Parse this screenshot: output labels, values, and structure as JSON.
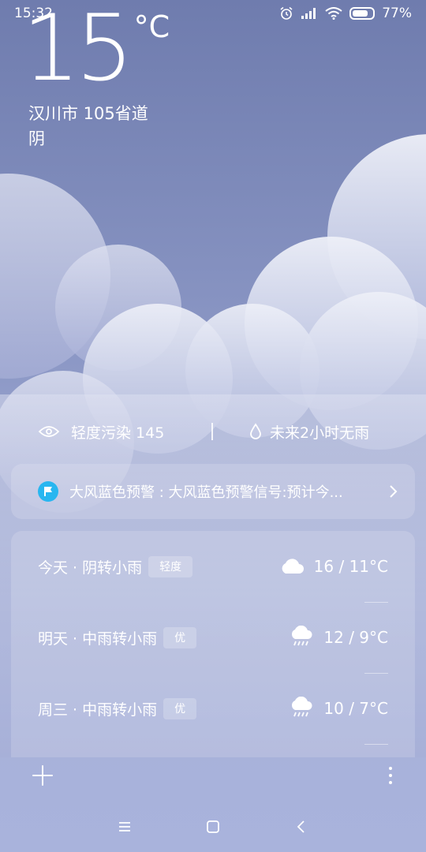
{
  "status_bar": {
    "time": "15:32",
    "battery": "77%",
    "battery_level": 0.77,
    "icons": [
      "alarm-icon",
      "signal-icon",
      "wifi-icon",
      "battery-icon"
    ]
  },
  "weather": {
    "temperature": "15",
    "unit": "°C",
    "location": "汉川市 105省道",
    "condition": "阴"
  },
  "info": {
    "air_quality": "轻度污染 145",
    "rain_forecast": "未来2小时无雨"
  },
  "alert": {
    "text": "大风蓝色预警 : 大风蓝色预警信号:预计今..."
  },
  "forecast": [
    {
      "day": "今天 · 阴转小雨",
      "aqi": "轻度",
      "icon": "cloud-icon",
      "temp": "16 / 11°C"
    },
    {
      "day": "明天 · 中雨转小雨",
      "aqi": "优",
      "icon": "rain-icon",
      "temp": "12 / 9°C"
    },
    {
      "day": "周三 · 中雨转小雨",
      "aqi": "优",
      "icon": "rain-icon",
      "temp": "10 / 7°C"
    }
  ],
  "colors": {
    "alert_badge": "#28b6f0",
    "background_top": "#6f7cae",
    "background_bottom": "#a9b3dc"
  }
}
